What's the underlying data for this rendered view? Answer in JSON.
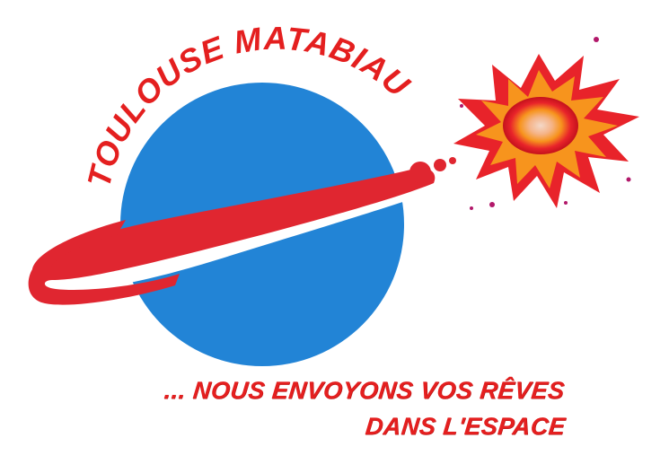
{
  "logo": {
    "arc_text": "TOULOUSE MATABIAU"
  },
  "tagline": {
    "line1": "... NOUS ENVOYONS VOS RÊVES",
    "line2": "DANS L'ESPACE"
  },
  "colors": {
    "planet": "#2284d6",
    "ring": "#e02630",
    "text": "#e41f1f",
    "explosion_outer": "#e8232a",
    "explosion_mid": "#f7941d",
    "explosion_core": "#f4c9b3"
  }
}
